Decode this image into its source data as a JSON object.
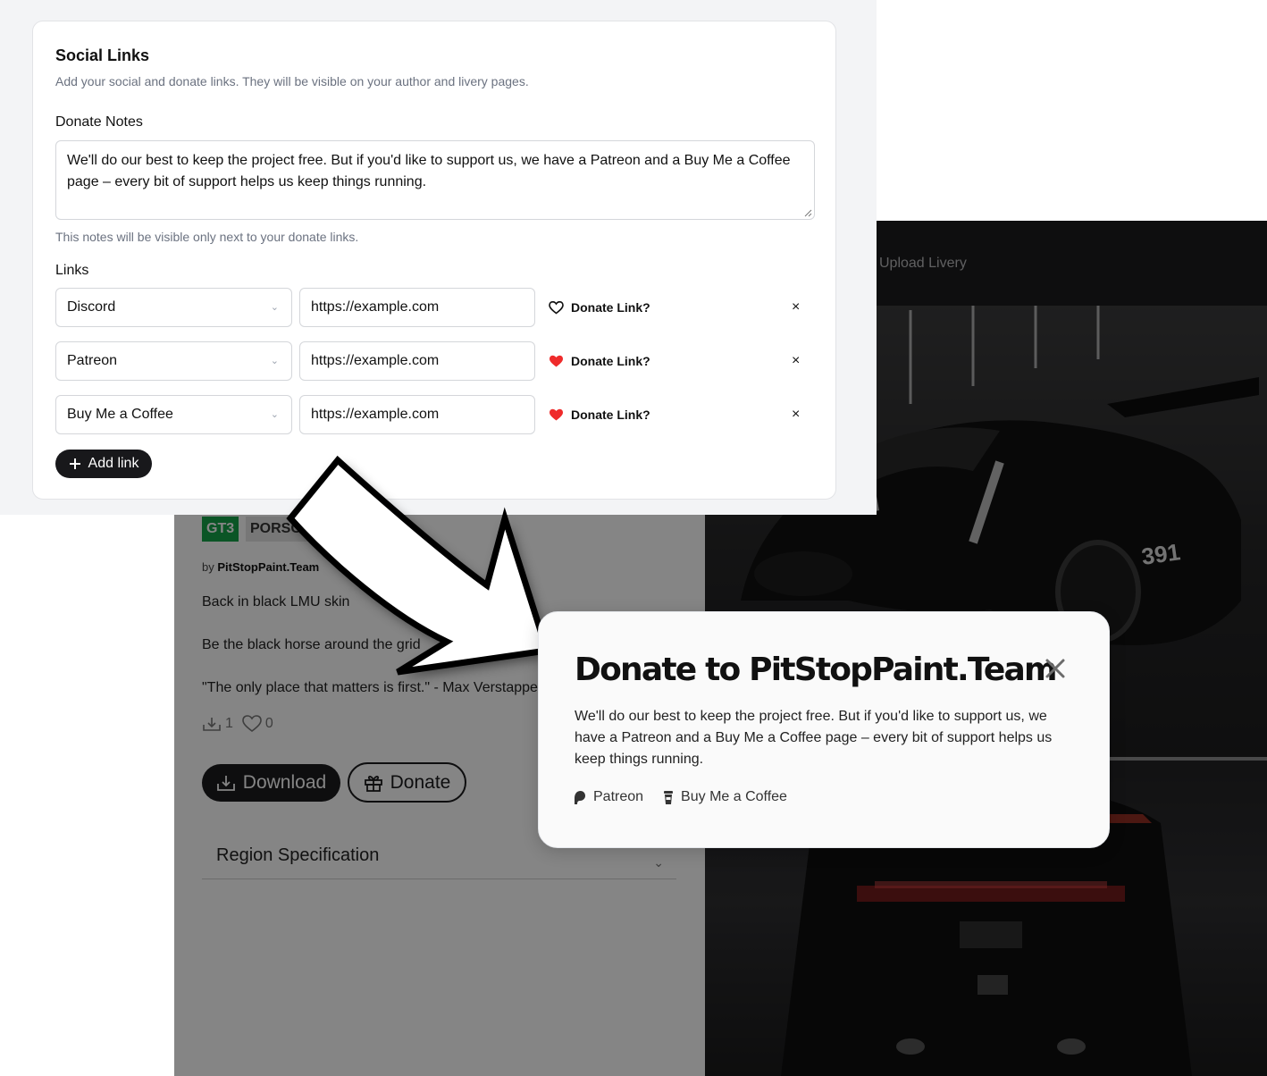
{
  "livery_page": {
    "header": {
      "upload_livery": "Upload Livery"
    },
    "tags": {
      "class": "GT3",
      "brand": "PORSCHE"
    },
    "author": {
      "prefix": "by",
      "name": "PitStopPaint.Team"
    },
    "description": [
      "Back in black LMU skin",
      "Be the black horse around the grid",
      "\"The only place that matters is first.\" - Max Verstappen"
    ],
    "stats": {
      "downloads": "1",
      "likes": "0"
    },
    "download_label": "Download",
    "donate_label": "Donate",
    "region_spec": "Region Specification"
  },
  "social_links": {
    "title": "Social Links",
    "subtitle": "Add your social and donate links. They will be visible on your author and livery pages.",
    "donate_notes_label": "Donate Notes",
    "donate_notes_value": "We'll do our best to keep the project free. But if you'd like to support us, we have a Patreon and a Buy Me a Coffee page – every bit of support helps us keep things running.",
    "donate_notes_hint": "This notes will be visible only next to your donate links.",
    "links_label": "Links",
    "rows": [
      {
        "platform": "Discord",
        "url": "https://example.com",
        "donate_label": "Donate Link?",
        "is_donate": false,
        "remove": "×"
      },
      {
        "platform": "Patreon",
        "url": "https://example.com",
        "donate_label": "Donate Link?",
        "is_donate": true,
        "remove": "×"
      },
      {
        "platform": "Buy Me a Coffee",
        "url": "https://example.com",
        "donate_label": "Donate Link?",
        "is_donate": true,
        "remove": "×"
      }
    ],
    "add_link_label": "Add link"
  },
  "donate_modal": {
    "title": "Donate to PitStopPaint.Team",
    "notes": "We'll do our best to keep the project free. But if you'd like to support us, we have a Patreon and a Buy Me a Coffee page – every bit of support helps us keep things running.",
    "links": [
      {
        "label": "Patreon",
        "icon": "patreon-icon"
      },
      {
        "label": "Buy Me a Coffee",
        "icon": "coffee-cup-icon"
      }
    ]
  },
  "colors": {
    "accent_dark": "#18181b",
    "heart_red": "#ef2b2b",
    "gt3_green": "#16a34a"
  }
}
